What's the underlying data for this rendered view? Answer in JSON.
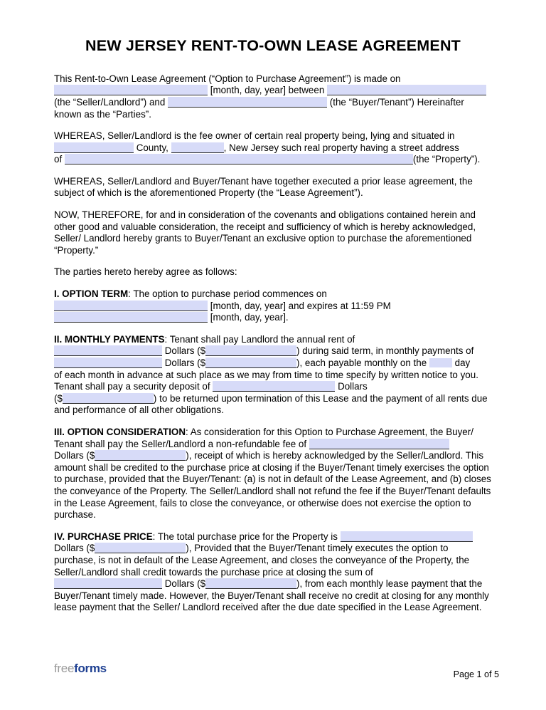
{
  "document": {
    "title": "NEW JERSEY RENT-TO-OWN LEASE AGREEMENT",
    "field_fill_color": "#d7dbf8",
    "field_line_color": "#2b2b2b"
  },
  "intro": {
    "line1": "This Rent-to-Own Lease Agreement (“Option to Purchase Agreement”) is made on",
    "date_label": "[month, day, year] between",
    "seller_label": "(the “Seller/Landlord”) and",
    "buyer_label": "(the “Buyer/Tenant”) Hereinafter",
    "line_end": "known as the “Parties”."
  },
  "whereas1": {
    "line1": "WHEREAS, Seller/Landlord is the fee owner of certain real property being, lying and situated in",
    "county_label": "County,",
    "state_label": ", New Jersey such real property having a street address",
    "of_label": "of",
    "property_label": "(the “Property”)."
  },
  "whereas2": {
    "text": "WHEREAS, Seller/Landlord and Buyer/Tenant have together executed a prior lease agreement, the subject of which is the aforementioned Property (the “Lease Agreement”)."
  },
  "now_therefore": {
    "text": "NOW, THEREFORE, for and in consideration of the covenants and obligations contained herein and other good and valuable consideration, the receipt and sufficiency of which is hereby acknowledged, Seller/ Landlord hereby grants to Buyer/Tenant an exclusive option to purchase the aforementioned “Property.”"
  },
  "agree_line": {
    "text": "The parties hereto hereby agree as follows:"
  },
  "section1": {
    "heading": "I. OPTION TERM",
    "intro": ": The option to purchase period commences on",
    "date1_label": "[month, day, year] and expires at 11:59 PM",
    "date2_label": "[month, day, year]."
  },
  "section2": {
    "heading": "II. MONTHLY PAYMENTS",
    "intro": ": Tenant shall pay Landlord the annual rent of",
    "dollars1": "Dollars ($",
    "after_amount1": ") during said term, in monthly payments of",
    "dollars2": "Dollars ($",
    "after_amount2": "), each payable monthly on the",
    "day_word": "day",
    "body1": "of each month in advance at such place as we may from time to time specify by written notice to you. Tenant shall pay a security deposit of",
    "deposit_dollars": "Dollars",
    "paren_dollar": "($",
    "body2": ") to be returned upon termination of this Lease and the payment of all rents due and performance of all other obligations."
  },
  "section3": {
    "heading": "III. OPTION CONSIDERATION",
    "intro": ": As consideration for this Option to Purchase Agreement, the Buyer/ Tenant shall pay the Seller/Landlord a non-refundable fee of",
    "dollars": "Dollars ($",
    "body": "), receipt of which is hereby acknowledged by the Seller/Landlord. This amount shall be credited to the purchase price at closing if the Buyer/Tenant timely exercises the option to purchase, provided that the Buyer/Tenant: (a) is not in default of the Lease Agreement, and (b) closes the conveyance of the Property. The Seller/Landlord shall not refund the fee if the Buyer/Tenant defaults in the Lease Agreement, fails to close the conveyance, or otherwise does not exercise the option to purchase."
  },
  "section4": {
    "heading": "IV. PURCHASE PRICE",
    "intro": ": The total purchase price for the Property is",
    "dollars1": "Dollars ($",
    "body1": "), Provided that the Buyer/Tenant timely executes the option to purchase, is not in default of the Lease Agreement, and closes the conveyance of the Property, the Seller/Landlord shall credit towards the purchase price at closing the sum of",
    "dollars2": "Dollars ($",
    "body2": "), from each monthly lease payment that the Buyer/Tenant timely made. However, the Buyer/Tenant shall receive no credit at closing for any monthly lease payment that the Seller/ Landlord received after the due date specified in the Lease Agreement."
  },
  "footer": {
    "logo_part1": "free",
    "logo_part2": "forms",
    "page_number": "Page 1 of 5",
    "logo_color_gray": "#9a9a9a",
    "logo_color_blue": "#1d3f91"
  }
}
